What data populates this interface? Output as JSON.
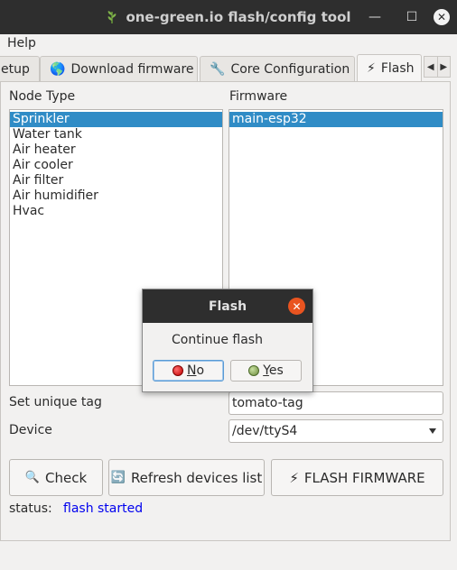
{
  "window": {
    "title": "one-green.io flash/config tool",
    "minimize_glyph": "—",
    "maximize_glyph": "☐",
    "close_glyph": "✕"
  },
  "menu": {
    "help": "Help"
  },
  "tabs": [
    {
      "label": "etup",
      "icon": ""
    },
    {
      "label": "Download firmware",
      "icon": "🌎"
    },
    {
      "label": "Core Configuration",
      "icon": "🔧"
    },
    {
      "label": "Flash",
      "icon": "⚡"
    }
  ],
  "tab_scroll": {
    "left": "◀",
    "right": "▶"
  },
  "node_type": {
    "label": "Node Type",
    "items": [
      "Sprinkler",
      "Water tank",
      "Air heater",
      "Air cooler",
      "Air filter",
      "Air humidifier",
      "Hvac"
    ],
    "selected_index": 0
  },
  "firmware": {
    "label": "Firmware",
    "items": [
      "main-esp32"
    ],
    "selected_index": 0
  },
  "unique_tag": {
    "label": "Set unique tag",
    "value": "tomato-tag"
  },
  "device": {
    "label": "Device",
    "value": "/dev/ttyS4"
  },
  "buttons": {
    "check": {
      "label": "Check",
      "icon": "🔍"
    },
    "refresh": {
      "label": "Refresh devices list",
      "icon": "🔄"
    },
    "flash": {
      "label": "FLASH FIRMWARE",
      "icon": "⚡"
    }
  },
  "status": {
    "label": "status:",
    "value": "flash started"
  },
  "dialog": {
    "title": "Flash",
    "message": "Continue flash",
    "no_label_mnemonic": "N",
    "no_label_rest": "o",
    "yes_label_mnemonic": "Y",
    "yes_label_rest": "es",
    "close_glyph": "✕"
  },
  "colors": {
    "titlebar": "#2e2e2e",
    "selection": "#308cc6",
    "status_text": "#0000ee",
    "dialog_close": "#e95420"
  }
}
